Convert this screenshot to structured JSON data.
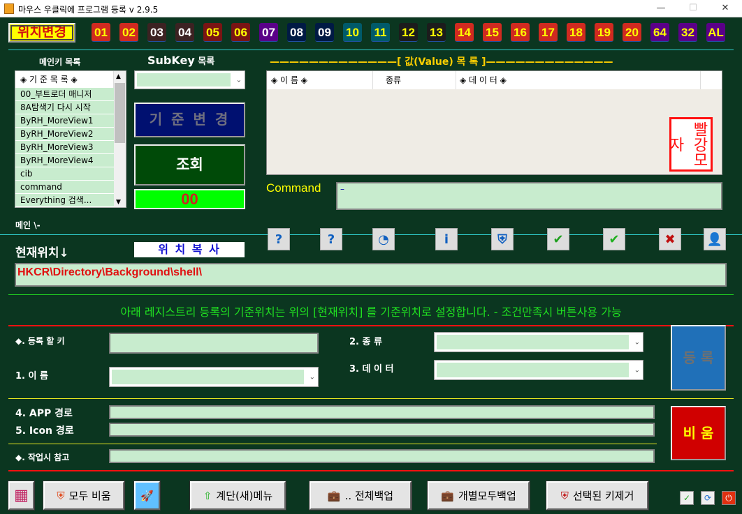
{
  "window": {
    "title": "마우스 우클릭에 프로그램 등록  v 2.9.5",
    "minimize": "—",
    "maximize": "☐",
    "close": "✕"
  },
  "position_change_label": "위치변경",
  "number_buttons": [
    {
      "label": "01",
      "bg": "#d02a20",
      "fg": "#ffff00"
    },
    {
      "label": "02",
      "bg": "#d02a20",
      "fg": "#ffff00"
    },
    {
      "label": "03",
      "bg": "#3c2222",
      "fg": "#ffffff"
    },
    {
      "label": "04",
      "bg": "#3c2222",
      "fg": "#ffffff"
    },
    {
      "label": "05",
      "bg": "#7a1414",
      "fg": "#ffff00"
    },
    {
      "label": "06",
      "bg": "#7a1414",
      "fg": "#ffff00"
    },
    {
      "label": "07",
      "bg": "#5a0088",
      "fg": "#ffffff"
    },
    {
      "label": "08",
      "bg": "#001a44",
      "fg": "#ffffff"
    },
    {
      "label": "09",
      "bg": "#001a44",
      "fg": "#ffffff"
    },
    {
      "label": "10",
      "bg": "#005a6a",
      "fg": "#ffff00"
    },
    {
      "label": "11",
      "bg": "#005a6a",
      "fg": "#ffff00"
    },
    {
      "label": "12",
      "bg": "#1c1c1c",
      "fg": "#ffff00"
    },
    {
      "label": "13",
      "bg": "#1c1c1c",
      "fg": "#ffff00"
    },
    {
      "label": "14",
      "bg": "#d02a20",
      "fg": "#ffff00"
    },
    {
      "label": "15",
      "bg": "#d02a20",
      "fg": "#ffff00"
    },
    {
      "label": "16",
      "bg": "#d02a20",
      "fg": "#ffff00"
    },
    {
      "label": "17",
      "bg": "#d02a20",
      "fg": "#ffff00"
    },
    {
      "label": "18",
      "bg": "#d02a20",
      "fg": "#ffff00"
    },
    {
      "label": "19",
      "bg": "#d02a20",
      "fg": "#ffff00"
    },
    {
      "label": "20",
      "bg": "#d02a20",
      "fg": "#ffff00"
    },
    {
      "label": "64",
      "bg": "#5a0088",
      "fg": "#ffff00"
    },
    {
      "label": "32",
      "bg": "#5a0088",
      "fg": "#ffff00"
    },
    {
      "label": "AL",
      "bg": "#5a0088",
      "fg": "#ffff00"
    }
  ],
  "mainkey": {
    "title": "메인키 목록",
    "header": "◈ 기 준 목 록 ◈",
    "items": [
      "00_부트로더 매니저",
      "8A탐색기 다시 시작",
      "ByRH_MoreView1",
      "ByRH_MoreView2",
      "ByRH_MoreView3",
      "ByRH_MoreView4",
      "cib",
      "command",
      "Everything 검색..."
    ]
  },
  "subkey": {
    "title_bold": "SubKey",
    "title_rest": " 목록",
    "value": ""
  },
  "base_change_label": "기 준 변 경",
  "lookup_label": "조회",
  "counter": "00",
  "values": {
    "title": "—————————————[  값(Value) 목 록  ]—————————————",
    "columns": [
      "◈ 이 름 ◈",
      "종류",
      "◈ 데 이 터 ◈"
    ]
  },
  "command": {
    "label": "Command",
    "value": "–"
  },
  "main_path": "메인 \\-",
  "current_position_label": "현재위치↓",
  "copy_position_label": "위 치 복 사",
  "current_path": "HKCR\\Directory\\Background\\shell\\",
  "notice": "아래 레지스트리 등록의 기준위치는 위의 [현재위치] 를 기준위치로 설정합니다.  - 조건만족시 버튼사용 가능",
  "form": {
    "key_label": "◆. 등록 할 키",
    "name_label": "1. 이      름",
    "type_label": "2. 종      류",
    "data_label": "3. 데 이 터",
    "app_label": "4. APP 경로",
    "icon_label": "5. Icon 경로",
    "note_label": "◆. 작업시 참고",
    "register_label": "등 록",
    "clear_label": "비 움"
  },
  "toolbar_icons": [
    "help-circle-icon",
    "shield-help-icon",
    "clock-arrow-icon",
    "info-icon",
    "shield-globe-icon",
    "users-check-icon",
    "check-circle-icon",
    "shield-x-icon",
    "user-icon"
  ],
  "bottom": {
    "clear_all": "모두 비움",
    "cascade_menu": "계단(새)메뉴",
    "full_backup": ".. 전체백업",
    "individual_backup": "개별모두백업",
    "delete_selected": "선택된 키제거"
  }
}
